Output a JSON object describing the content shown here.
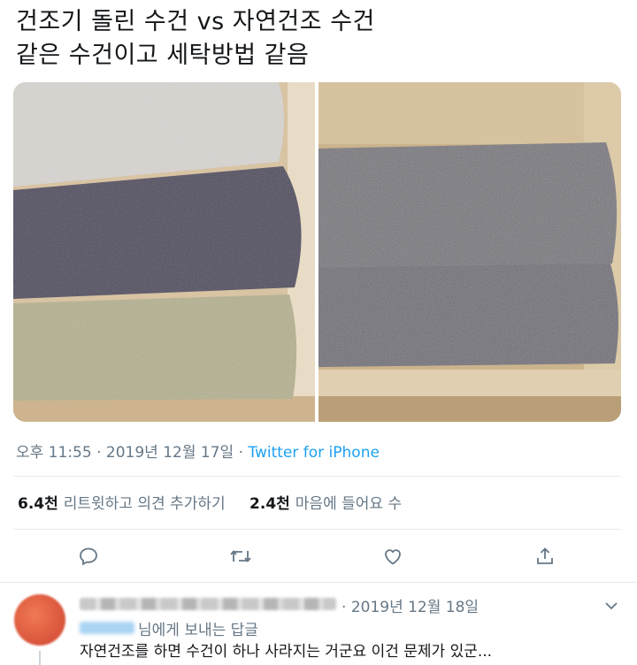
{
  "tweet": {
    "line1": "건조기 돌린 수건 vs 자연건조 수건",
    "line2": "같은 수건이고 세탁방법 같음"
  },
  "meta": {
    "time": "오후 11:55",
    "date": "2019년 12월 17일",
    "source": "Twitter for iPhone",
    "separator": "·"
  },
  "stats": {
    "retweets_count": "6.4천",
    "retweets_label": "리트윗하고 의견 추가하기",
    "likes_count": "2.4천",
    "likes_label": "마음에 들어요 수"
  },
  "actions": [
    "reply-icon",
    "retweet-icon",
    "like-icon",
    "share-icon"
  ],
  "colors": {
    "accent": "#1da1f2",
    "secondary_text": "#657786",
    "divider": "#e6ecf0"
  },
  "reply": {
    "date": "2019년 12월 18일",
    "replying_to": "님에게 보내는 답글",
    "text": "자연건조를 하면 수건이 하나 사라지는 거군요 이건 문제가 있군..."
  }
}
